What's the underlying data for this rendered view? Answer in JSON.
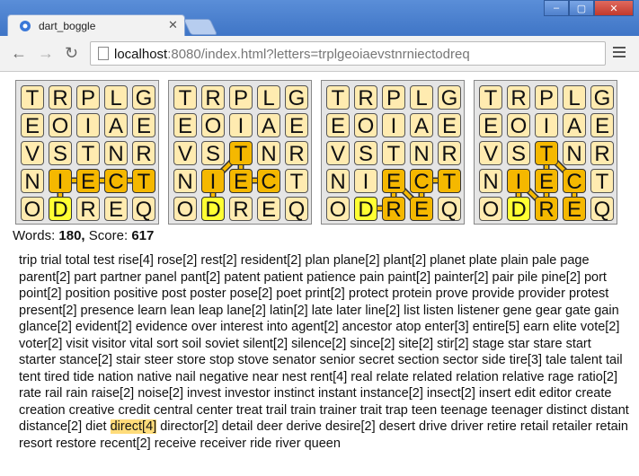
{
  "browser": {
    "tab_title": "dart_boggle",
    "url_host": "localhost",
    "url_rest": ":8080/index.html?letters=trplgeoiaevstnrniectodreq",
    "nav": {
      "back": "←",
      "forward": "→",
      "reload": "↻"
    }
  },
  "grid": [
    [
      "T",
      "R",
      "P",
      "L",
      "G"
    ],
    [
      "E",
      "O",
      "I",
      "A",
      "E"
    ],
    [
      "V",
      "S",
      "T",
      "N",
      "R"
    ],
    [
      "N",
      "I",
      "E",
      "C",
      "T"
    ],
    [
      "O",
      "D",
      "R",
      "E",
      "Q"
    ]
  ],
  "boards": [
    {
      "path": [
        [
          4,
          1
        ],
        [
          3,
          1
        ],
        [
          3,
          2
        ],
        [
          3,
          3
        ],
        [
          3,
          4
        ]
      ]
    },
    {
      "path": [
        [
          4,
          1
        ],
        [
          3,
          1
        ],
        [
          2,
          2
        ],
        [
          3,
          2
        ],
        [
          3,
          3
        ]
      ]
    },
    {
      "path": [
        [
          4,
          1
        ],
        [
          4,
          2
        ],
        [
          3,
          2
        ],
        [
          4,
          3
        ],
        [
          3,
          3
        ],
        [
          3,
          4
        ]
      ]
    },
    {
      "path": [
        [
          4,
          1
        ],
        [
          3,
          1
        ],
        [
          4,
          2
        ],
        [
          3,
          2
        ],
        [
          2,
          2
        ],
        [
          3,
          3
        ],
        [
          4,
          3
        ]
      ]
    }
  ],
  "stats": {
    "words_label": "Words:",
    "words_count": "180,",
    "score_label": "Score:",
    "score": "617"
  },
  "words": [
    "trip",
    "trial",
    "total",
    "test",
    "rise[4]",
    "rose[2]",
    "rest[2]",
    "resident[2]",
    "plan",
    "plane[2]",
    "plant[2]",
    "planet",
    "plate",
    "plain",
    "pale",
    "page",
    "parent[2]",
    "part",
    "partner",
    "panel",
    "pant[2]",
    "patent",
    "patient",
    "patience",
    "pain",
    "paint[2]",
    "painter[2]",
    "pair",
    "pile",
    "pine[2]",
    "port",
    "point[2]",
    "position",
    "positive",
    "post",
    "poster",
    "pose[2]",
    "poet",
    "print[2]",
    "protect",
    "protein",
    "prove",
    "provide",
    "provider",
    "protest",
    "present[2]",
    "presence",
    "learn",
    "lean",
    "leap",
    "lane[2]",
    "latin[2]",
    "late",
    "later",
    "line[2]",
    "list",
    "listen",
    "listener",
    "gene",
    "gear",
    "gate",
    "gain",
    "glance[2]",
    "evident[2]",
    "evidence",
    "over",
    "interest",
    "into",
    "agent[2]",
    "ancestor",
    "atop",
    "enter[3]",
    "entire[5]",
    "earn",
    "elite",
    "vote[2]",
    "voter[2]",
    "visit",
    "visitor",
    "vital",
    "sort",
    "soil",
    "soviet",
    "silent[2]",
    "silence[2]",
    "since[2]",
    "site[2]",
    "stir[2]",
    "stage",
    "star",
    "stare",
    "start",
    "starter",
    "stance[2]",
    "stair",
    "steer",
    "store",
    "stop",
    "stove",
    "senator",
    "senior",
    "secret",
    "section",
    "sector",
    "side",
    "tire[3]",
    "tale",
    "talent",
    "tail",
    "tent",
    "tired",
    "tide",
    "nation",
    "native",
    "nail",
    "negative",
    "near",
    "nest",
    "rent[4]",
    "real",
    "relate",
    "related",
    "relation",
    "relative",
    "rage",
    "ratio[2]",
    "rate",
    "rail",
    "rain",
    "raise[2]",
    "noise[2]",
    "invest",
    "investor",
    "instinct",
    "instant",
    "instance[2]",
    "insect[2]",
    "insert",
    "edit",
    "editor",
    "create",
    "creation",
    "creative",
    "credit",
    "central",
    "center",
    "treat",
    "trail",
    "train",
    "trainer",
    "trait",
    "trap",
    "teen",
    "teenage",
    "teenager",
    "distinct",
    "distant",
    "distance[2]",
    "diet",
    "direct[4]",
    "director[2]",
    "detail",
    "deer",
    "derive",
    "desire[2]",
    "desert",
    "drive",
    "driver",
    "retire",
    "retail",
    "retailer",
    "retain",
    "resort",
    "restore",
    "recent[2]",
    "receive",
    "receiver",
    "ride",
    "river",
    "queen"
  ],
  "highlight_word": "direct[4]",
  "colors": {
    "cell": "#ffebb0",
    "selected": "#f5b800",
    "first": "#ffff33",
    "highlight": "#ffdc7a"
  }
}
